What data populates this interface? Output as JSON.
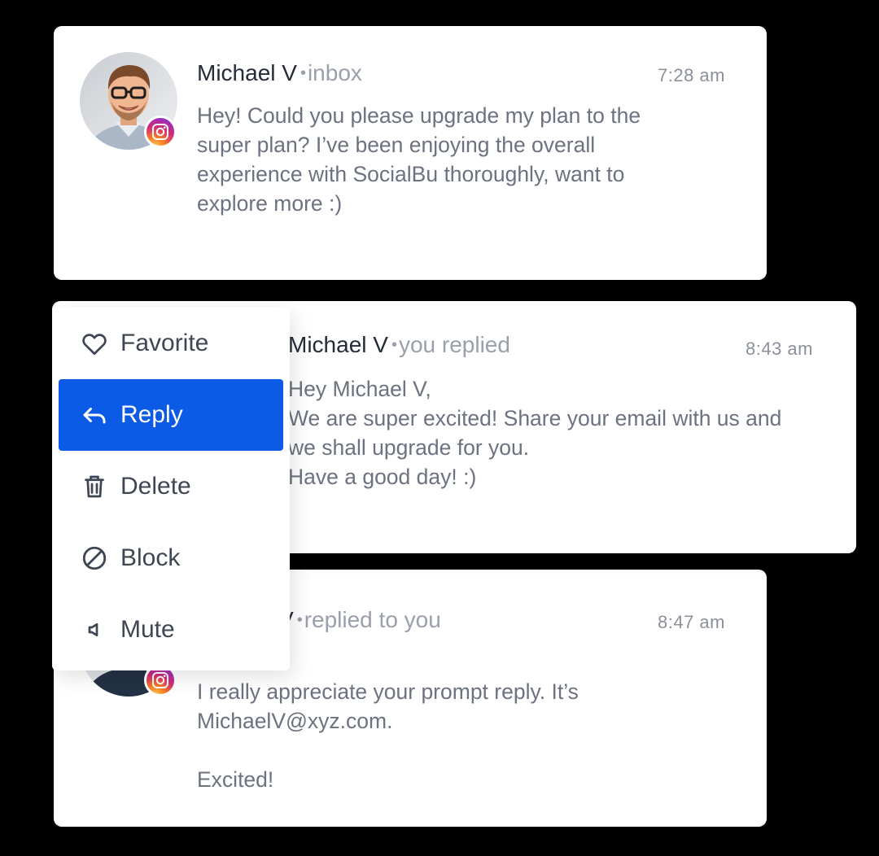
{
  "colors": {
    "accent": "#0b5be6",
    "background": "#000000",
    "card": "#ffffff",
    "text_body": "#6c7280",
    "text_name": "#252b37"
  },
  "messages": [
    {
      "sender": "Michael V",
      "status": "inbox",
      "time": "7:28 am",
      "body": "Hey! Could you please upgrade my plan to the\nsuper plan? I’ve been enjoying the overall\nexperience with SocialBu thoroughly, want to\nexplore more :)",
      "platform_icon": "instagram-icon"
    },
    {
      "sender": "Michael V",
      "status": "you replied",
      "time": "8:43 am",
      "body": "Hey Michael V,\nWe are super excited! Share your email with us and\nwe shall upgrade for you.\nHave a good day! :)"
    },
    {
      "sender_visible": "V",
      "status": "replied to you",
      "time": "8:47 am",
      "body": "e!\nI really appreciate your prompt reply. It’s\nMichaelV@xyz.com.\n\nExcited!",
      "platform_icon": "instagram-icon"
    }
  ],
  "context_menu": {
    "items": [
      {
        "label": "Favorite",
        "icon": "heart-icon",
        "active": false
      },
      {
        "label": "Reply",
        "icon": "reply-arrow-icon",
        "active": true
      },
      {
        "label": "Delete",
        "icon": "trash-icon",
        "active": false
      },
      {
        "label": "Block",
        "icon": "block-icon",
        "active": false
      },
      {
        "label": "Mute",
        "icon": "speaker-mute-icon",
        "active": false
      }
    ]
  }
}
